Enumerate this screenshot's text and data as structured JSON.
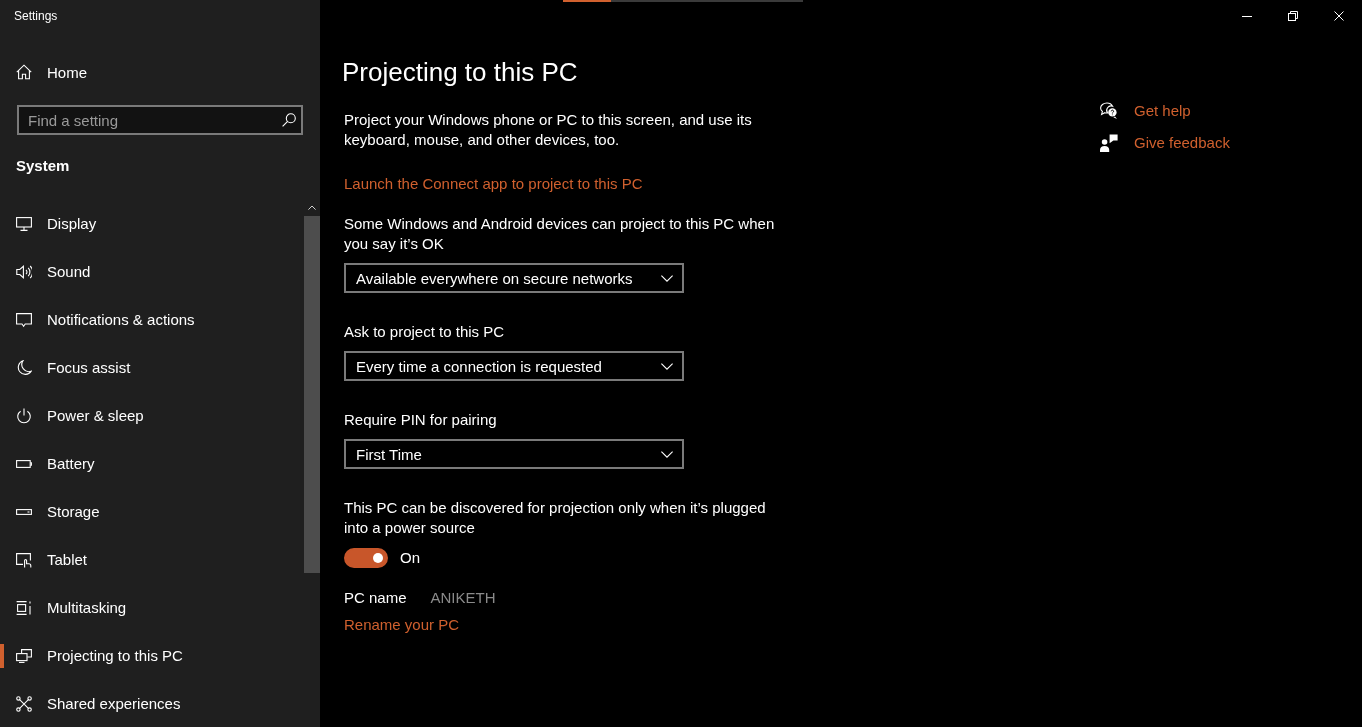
{
  "window": {
    "title": "Settings"
  },
  "loading_bar": {
    "level": 0.2
  },
  "sidebar": {
    "home": "Home",
    "search": {
      "placeholder": "Find a setting"
    },
    "section": "System",
    "items": [
      {
        "label": "Display",
        "selected": false
      },
      {
        "label": "Sound",
        "selected": false
      },
      {
        "label": "Notifications & actions",
        "selected": false
      },
      {
        "label": "Focus assist",
        "selected": false
      },
      {
        "label": "Power & sleep",
        "selected": false
      },
      {
        "label": "Battery",
        "selected": false
      },
      {
        "label": "Storage",
        "selected": false
      },
      {
        "label": "Tablet",
        "selected": false
      },
      {
        "label": "Multitasking",
        "selected": false
      },
      {
        "label": "Projecting to this PC",
        "selected": true
      },
      {
        "label": "Shared experiences",
        "selected": false
      }
    ]
  },
  "page": {
    "title": "Projecting to this PC",
    "description": "Project your Windows phone or PC to this screen, and use its keyboard, mouse, and other devices, too.",
    "link": "Launch the Connect app to project to this PC",
    "settings": [
      {
        "kind": "dropdown",
        "label": "Some Windows and Android devices can project to this PC when you say it’s OK",
        "value": "Available everywhere on secure networks"
      },
      {
        "kind": "dropdown",
        "label": "Ask to project to this PC",
        "value": "Every time a connection is requested"
      },
      {
        "kind": "dropdown",
        "label": "Require PIN for pairing",
        "value": "First Time"
      },
      {
        "kind": "toggle",
        "label": "This PC can be discovered for projection only when it’s plugged into a power source",
        "on": true,
        "state_text": "On"
      }
    ],
    "pc_name": {
      "label": "PC name",
      "value": "ANIKETH"
    },
    "rename_link": "Rename your PC"
  },
  "help": {
    "links": [
      {
        "label": "Get help"
      },
      {
        "label": "Give feedback"
      }
    ]
  }
}
